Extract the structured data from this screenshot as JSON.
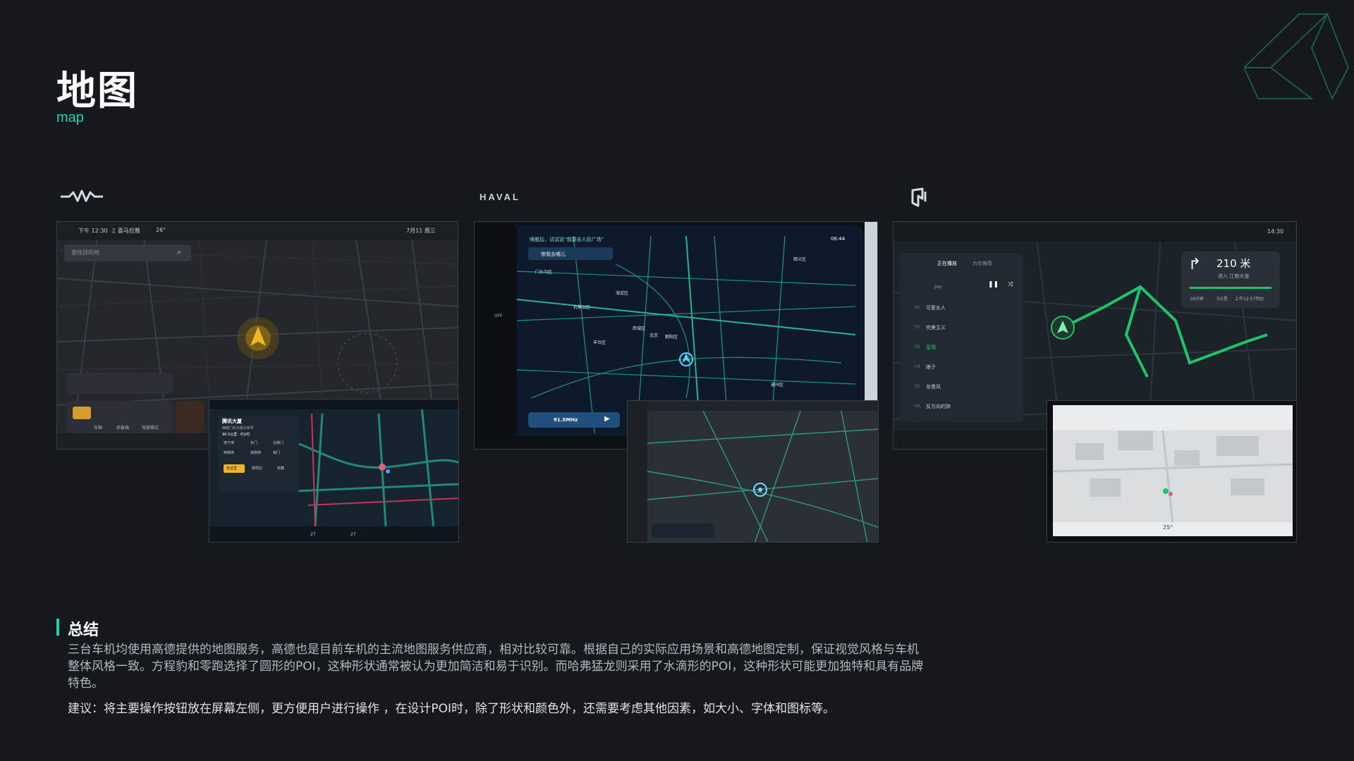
{
  "page": {
    "title": "地图",
    "subtitle": "map"
  },
  "brands": {
    "haval": "HAVAL"
  },
  "screens": {
    "leopard": {
      "status_time": "下午 12:30",
      "status_music": "♫ 喜马拉雅",
      "status_weather": "26°",
      "status_date": "7月11 周三",
      "search_placeholder": "查找目的地",
      "dock_items": [
        "车辆",
        "后备箱",
        "驾驶模式"
      ],
      "popup_title": "腾讯大厦",
      "popup_address": "西丽门外大街106号",
      "popup_distance": "96.5公里 · 约1时",
      "popup_tags": [
        "地下停",
        "东门",
        "北侧门",
        "西侧停",
        "南侧停",
        "南门"
      ],
      "popup_go": "去这里",
      "popup_search": "搜周边",
      "popup_fav": "收藏",
      "temp_left": "27",
      "temp_right": "27"
    },
    "haval": {
      "voice_hint": "唤醒后，试试说“我要去人民广场”",
      "search_placeholder": "带我去哪儿",
      "status_time": "06:44",
      "radio": "91.5MHz",
      "map_labels": [
        "门头沟区",
        "石景山区",
        "海淀区",
        "西城区",
        "北京",
        "朝阳区",
        "丰台区",
        "顺义区",
        "通州区"
      ],
      "side_off": "OFF"
    },
    "leapmotor": {
      "status_time": "14:30",
      "turn_distance": "210 米",
      "turn_road": "进入 江南大道",
      "eta_minutes": "18分钟",
      "eta_km": "3公里",
      "eta_arrival": "上午12:57到达",
      "music_tabs": [
        "正在播放",
        "为你推荐"
      ],
      "artist": "Jay",
      "playlist": [
        {
          "no": "01",
          "title": "可爱女人"
        },
        {
          "no": "02",
          "title": "完美主义"
        },
        {
          "no": "03",
          "title": "星晴"
        },
        {
          "no": "04",
          "title": "娘子"
        },
        {
          "no": "05",
          "title": "龙卷风"
        },
        {
          "no": "06",
          "title": "反方向的钟"
        }
      ],
      "temp": "25°"
    }
  },
  "summary": {
    "title": "总结",
    "body": "三台车机均使用高德提供的地图服务，高德也是目前车机的主流地图服务供应商，相对比较可靠。根据自己的实际应用场景和高德地图定制，保证视觉风格与车机整体风格一致。方程豹和零跑选择了圆形的POI，这种形状通常被认为更加简洁和易于识别。而哈弗猛龙则采用了水滴形的POI，这种形状可能更加独特和具有品牌特色。",
    "advice": "建议：将主要操作按钮放在屏幕左侧，更方便用户进行操作 ，在设计POI时，除了形状和颜色外，还需要考虑其他因素，如大小、字体和图标等。"
  },
  "colors": {
    "accent": "#1fd6a8",
    "background": "#15181c",
    "route_green": "#1ec46a",
    "map_teal": "#1aa68a",
    "poi_yellow": "#f0b429"
  },
  "icons": [
    "leopard-logo-icon",
    "haval-logo-icon",
    "leapmotor-logo-icon",
    "triangle-deco-icon"
  ]
}
